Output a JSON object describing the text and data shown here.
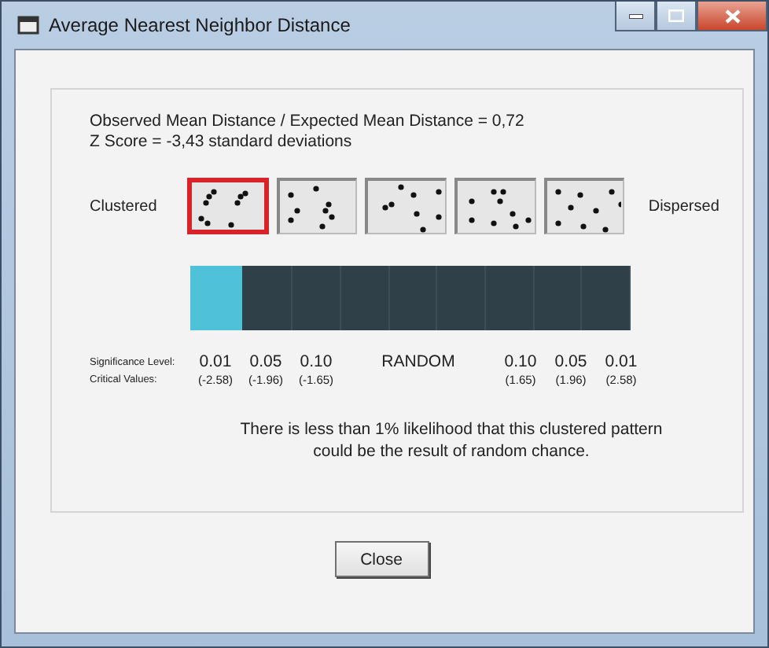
{
  "window": {
    "title": "Average Nearest Neighbor Distance"
  },
  "summary": [
    "Observed Mean Distance / Expected Mean Distance = 0,72",
    "Z Score = -3,43 standard deviations"
  ],
  "scale": {
    "left_label": "Clustered",
    "right_label": "Dispersed",
    "patterns": [
      {
        "selected": true
      },
      {
        "selected": false
      },
      {
        "selected": false
      },
      {
        "selected": false
      },
      {
        "selected": false
      }
    ]
  },
  "bar": {
    "level": 0.12
  },
  "significance": {
    "level_label": "Significance Level:",
    "critical_label": "Critical Values:",
    "columns": [
      {
        "level": "0.01",
        "critical": "(-2.58)"
      },
      {
        "level": "0.05",
        "critical": "(-1.96)"
      },
      {
        "level": "0.10",
        "critical": "(-1.65)"
      },
      {
        "level": "RANDOM"
      },
      {
        "level": "0.10",
        "critical": "(1.65)"
      },
      {
        "level": "0.05",
        "critical": "(1.96)"
      },
      {
        "level": "0.01",
        "critical": "(2.58)"
      }
    ]
  },
  "message": "There is less than 1% likelihood that this clustered pattern could be the result of random chance.",
  "buttons": [
    "Close"
  ]
}
